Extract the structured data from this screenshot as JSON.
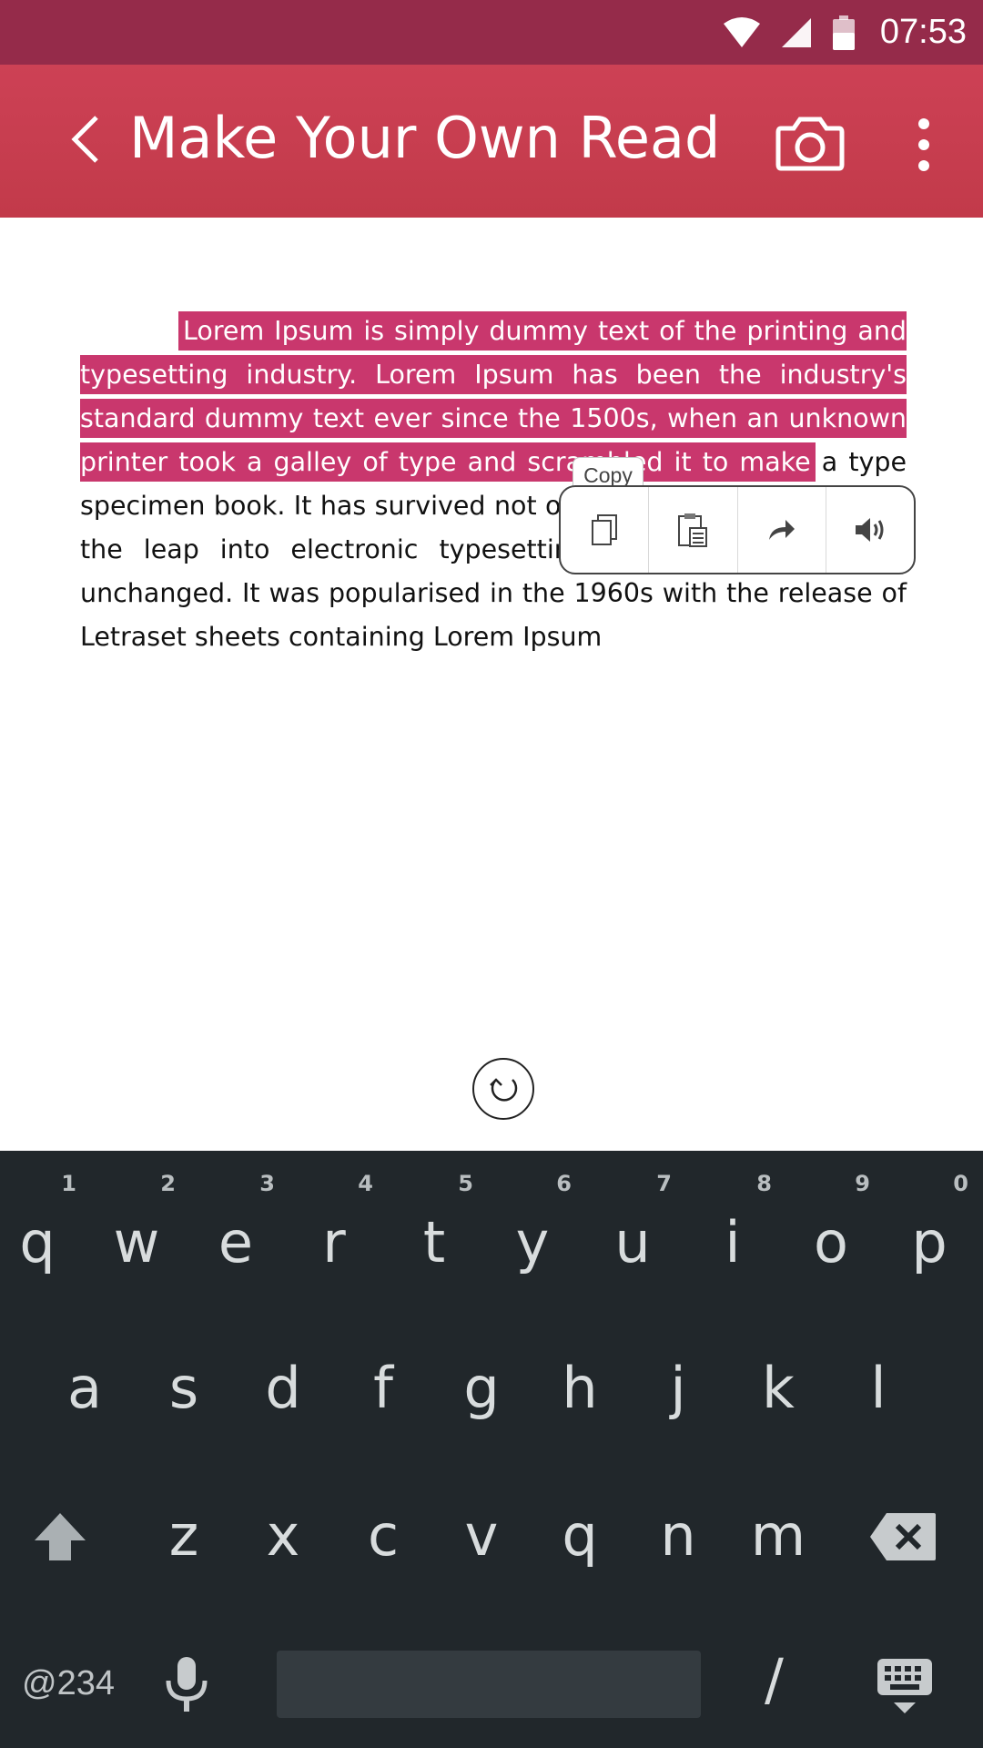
{
  "status_bar": {
    "time": "07:53"
  },
  "app_bar": {
    "title": "Make Your Own Read"
  },
  "content": {
    "selected_text": "Lorem Ipsum is simply dummy text of the printing and typesetting industry. Lorem Ipsum has been the industry's standard dummy text ever since the 1500s, when an unknown printer took a galley of type and scrambled it to make",
    "rest_text": " a type specimen book. It has survived not only five centuries, but also the leap into electronic typesetting, remaining essentially unchanged. It was popularised in the 1960s with the release of Letraset sheets containing Lorem Ipsum"
  },
  "popup": {
    "tooltip": "Copy"
  },
  "keyboard": {
    "row1": [
      "q",
      "w",
      "e",
      "r",
      "t",
      "y",
      "u",
      "i",
      "o",
      "p"
    ],
    "row1_hints": [
      "1",
      "2",
      "3",
      "4",
      "5",
      "6",
      "7",
      "8",
      "9",
      "0"
    ],
    "row2": [
      "a",
      "s",
      "d",
      "f",
      "g",
      "h",
      "j",
      "k",
      "l"
    ],
    "row3": [
      "z",
      "x",
      "c",
      "v",
      "q",
      "n",
      "m"
    ],
    "symbols_label": "@234",
    "slash": "/"
  }
}
